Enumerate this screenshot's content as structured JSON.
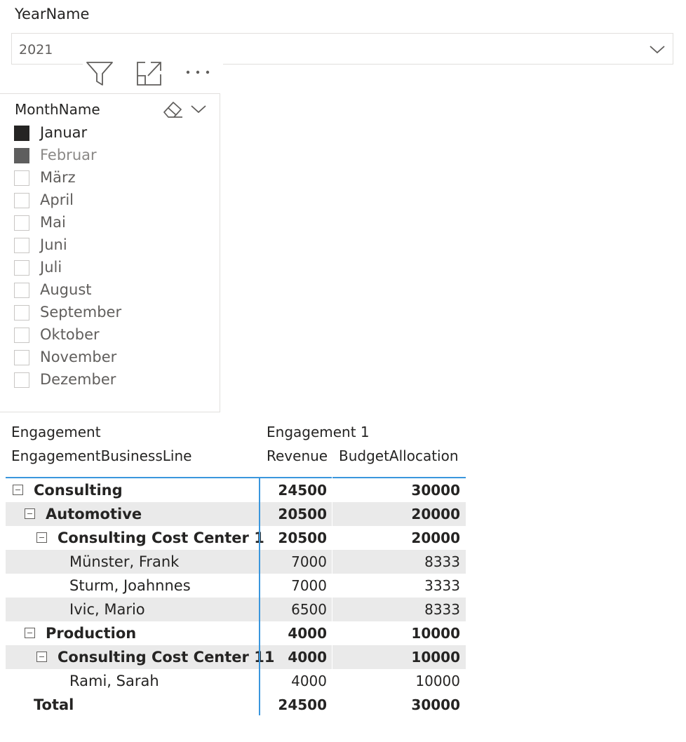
{
  "year_slicer": {
    "title": "YearName",
    "selected": "2021"
  },
  "visual_header": {
    "icons": [
      "filter-icon",
      "focus-mode-icon",
      "more-options-icon"
    ]
  },
  "month_slicer": {
    "title": "MonthName",
    "items": [
      {
        "label": "Januar",
        "state": "on"
      },
      {
        "label": "Februar",
        "state": "half"
      },
      {
        "label": "März",
        "state": "off"
      },
      {
        "label": "April",
        "state": "off"
      },
      {
        "label": "Mai",
        "state": "off"
      },
      {
        "label": "Juni",
        "state": "off"
      },
      {
        "label": "Juli",
        "state": "off"
      },
      {
        "label": "August",
        "state": "off"
      },
      {
        "label": "September",
        "state": "off"
      },
      {
        "label": "Oktober",
        "state": "off"
      },
      {
        "label": "November",
        "state": "off"
      },
      {
        "label": "Dezember",
        "state": "off"
      }
    ]
  },
  "matrix": {
    "row_header_1": "Engagement",
    "row_header_2": "EngagementBusinessLine",
    "column_group": "Engagement 1",
    "col_revenue": "Revenue",
    "col_budget": "BudgetAllocation",
    "rows": [
      {
        "label": "Consulting",
        "level": 0,
        "expander": true,
        "bold": true,
        "revenue": "24500",
        "budget": "30000"
      },
      {
        "label": "Automotive",
        "level": 1,
        "expander": true,
        "bold": true,
        "revenue": "20500",
        "budget": "20000"
      },
      {
        "label": "Consulting Cost Center 1",
        "level": 2,
        "expander": true,
        "bold": true,
        "revenue": "20500",
        "budget": "20000"
      },
      {
        "label": "Münster, Frank",
        "level": 3,
        "expander": false,
        "bold": false,
        "revenue": "7000",
        "budget": "8333"
      },
      {
        "label": "Sturm, Joahnnes",
        "level": 3,
        "expander": false,
        "bold": false,
        "revenue": "7000",
        "budget": "3333"
      },
      {
        "label": "Ivic, Mario",
        "level": 3,
        "expander": false,
        "bold": false,
        "revenue": "6500",
        "budget": "8333"
      },
      {
        "label": "Production",
        "level": 1,
        "expander": true,
        "bold": true,
        "revenue": "4000",
        "budget": "10000"
      },
      {
        "label": "Consulting Cost Center 11",
        "level": 2,
        "expander": true,
        "bold": true,
        "revenue": "4000",
        "budget": "10000"
      },
      {
        "label": "Rami, Sarah",
        "level": 3,
        "expander": false,
        "bold": false,
        "revenue": "4000",
        "budget": "10000"
      },
      {
        "label": "Total",
        "level": "total",
        "expander": false,
        "bold": true,
        "revenue": "24500",
        "budget": "30000"
      }
    ]
  }
}
